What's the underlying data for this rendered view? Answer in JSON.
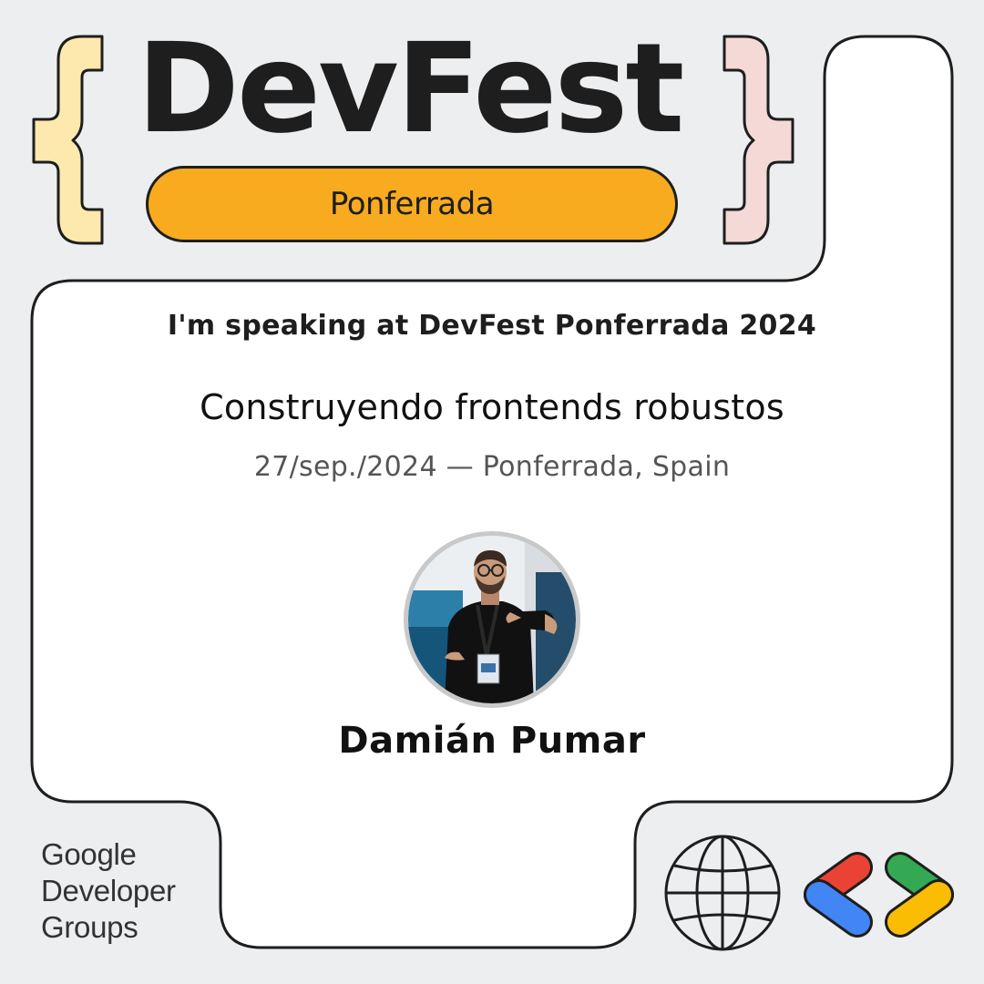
{
  "event": {
    "title": "DevFest",
    "city": "Ponferrada"
  },
  "speaking": {
    "tagline": "I'm speaking at DevFest Ponferrada 2024",
    "talk_title": "Construyendo frontends robustos",
    "date_location": "27/sep./2024 — Ponferrada, Spain"
  },
  "speaker": {
    "name": "Damián Pumar"
  },
  "organizer": {
    "lines": [
      "Google",
      "Developer",
      "Groups"
    ]
  },
  "icons": {
    "globe": "globe-icon",
    "gdg_logo": "gdg-brackets-logo"
  },
  "colors": {
    "background": "#edeef0",
    "card": "#ffffff",
    "ink": "#1e1e1e",
    "city_pill": "#f8ab1f",
    "left_brace": "#fde9ad",
    "right_brace": "#f4d9d6",
    "google_red": "#ea4335",
    "google_blue": "#4285f4",
    "google_green": "#34a853",
    "google_yellow": "#fbbc04"
  }
}
